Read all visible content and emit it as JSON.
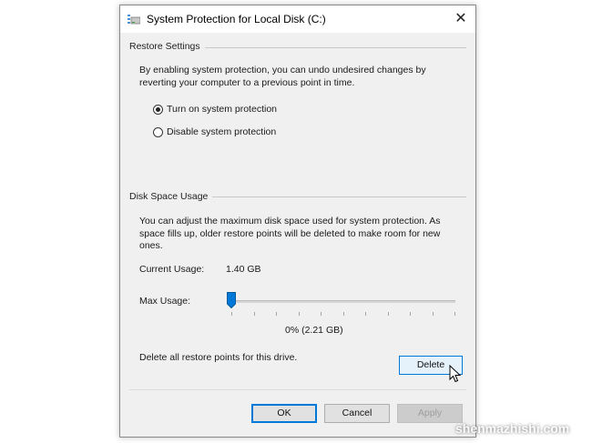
{
  "window": {
    "title": "System Protection for Local Disk (C:)",
    "close_glyph": "✕",
    "icon": "drive-protection-icon"
  },
  "restore_settings": {
    "header": "Restore Settings",
    "description_line1": "By enabling system protection, you can undo undesired changes by",
    "description_line2": "reverting your computer to a previous point in time.",
    "options": [
      {
        "label": "Turn on system protection",
        "selected": true
      },
      {
        "label": "Disable system protection",
        "selected": false
      }
    ]
  },
  "disk_space": {
    "header": "Disk Space Usage",
    "description_line1": "You can adjust the maximum disk space used for system protection. As",
    "description_line2": "space fills up, older restore points will be deleted to make room for new",
    "description_line3": "ones.",
    "current_usage_label": "Current Usage:",
    "current_usage_value": "1.40 GB",
    "max_usage_label": "Max Usage:",
    "max_usage_fraction": 0.0,
    "max_usage_readout": "0% (2.21 GB)",
    "delete_text": "Delete all restore points for this drive.",
    "delete_label": "Delete"
  },
  "footer": {
    "ok_label": "OK",
    "cancel_label": "Cancel",
    "apply_label": "Apply"
  },
  "watermark": "shenmazhishi.com",
  "colors": {
    "accent": "#0078d7",
    "dialog_bg": "#f0f0f0"
  }
}
